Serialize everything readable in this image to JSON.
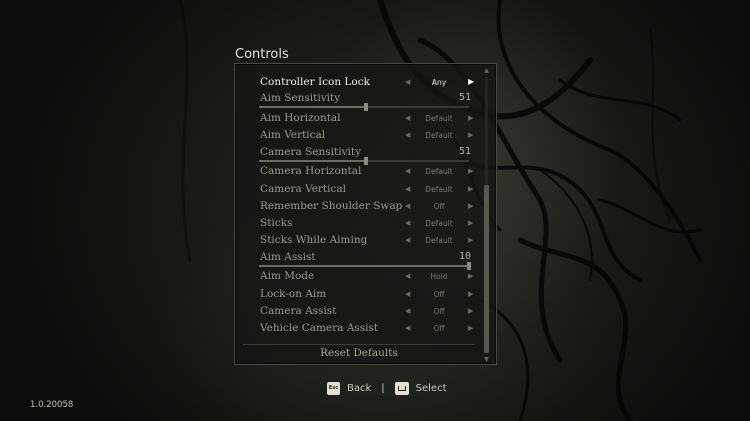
{
  "screen": {
    "title": "Controls",
    "version": "1.0.20058"
  },
  "settings": [
    {
      "kind": "option",
      "label": "Controller Icon Lock",
      "value": "Any",
      "active": true
    },
    {
      "kind": "slider",
      "label": "Aim Sensitivity",
      "value": "51",
      "level": 0.51
    },
    {
      "kind": "option",
      "label": "Aim Horizontal",
      "value": "Default"
    },
    {
      "kind": "option",
      "label": "Aim Vertical",
      "value": "Default"
    },
    {
      "kind": "slider",
      "label": "Camera Sensitivity",
      "value": "51",
      "level": 0.51
    },
    {
      "kind": "option",
      "label": "Camera Horizontal",
      "value": "Default"
    },
    {
      "kind": "option",
      "label": "Camera Vertical",
      "value": "Default"
    },
    {
      "kind": "option",
      "label": "Remember Shoulder Swap",
      "value": "Off"
    },
    {
      "kind": "option",
      "label": "Sticks",
      "value": "Default"
    },
    {
      "kind": "option",
      "label": "Sticks While Aiming",
      "value": "Default"
    },
    {
      "kind": "slider",
      "label": "Aim Assist",
      "value": "10",
      "level": 1.0
    },
    {
      "kind": "option",
      "label": "Aim Mode",
      "value": "Hold"
    },
    {
      "kind": "option",
      "label": "Lock-on Aim",
      "value": "Off"
    },
    {
      "kind": "option",
      "label": "Camera Assist",
      "value": "Off"
    },
    {
      "kind": "option",
      "label": "Vehicle Camera Assist",
      "value": "Off"
    }
  ],
  "reset_label": "Reset Defaults",
  "scrollbar": {
    "thumb_start": 0.39,
    "thumb_end": 1.0
  },
  "hints": {
    "back_key": "Esc",
    "back_label": "Back",
    "separator": "|",
    "select_label": "Select"
  },
  "icons": {
    "left_arrow": "arrow-left-icon",
    "right_arrow": "arrow-right-icon",
    "enter_key": "enter-key-icon"
  },
  "colors": {
    "panel_bg": "#161613",
    "active_text": "#f0eee6",
    "inactive_text": "#9e9a8e"
  }
}
